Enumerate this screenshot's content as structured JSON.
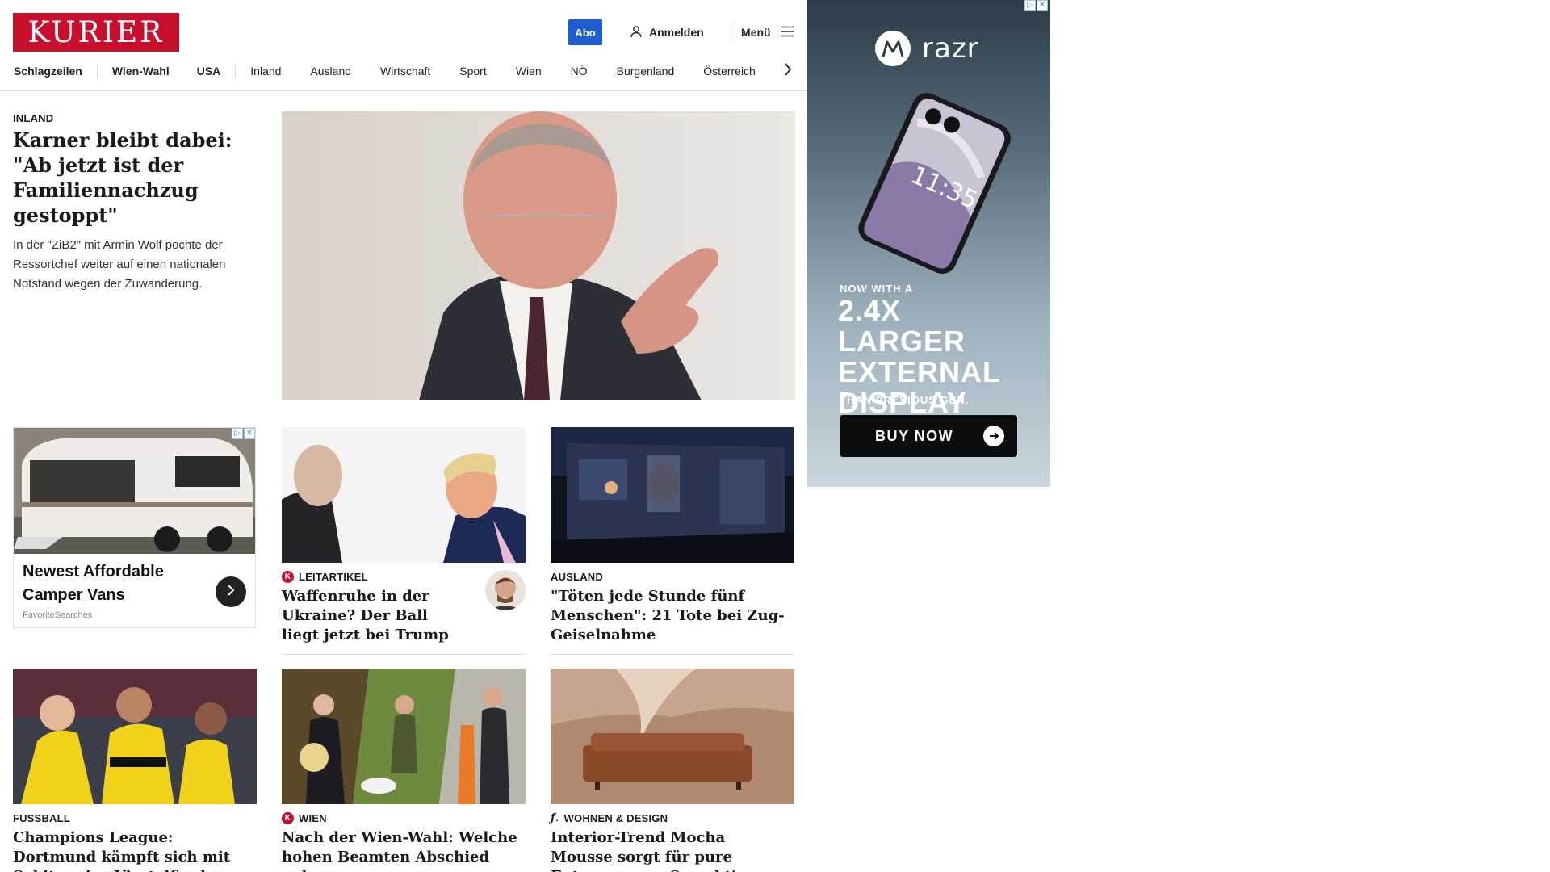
{
  "header": {
    "logo_text": "KURIER",
    "abo_label": "Abo",
    "login_label": "Anmelden",
    "menu_label": "Menü"
  },
  "nav": {
    "items": [
      "Schlagzeilen",
      "Wien-Wahl",
      "USA",
      "Inland",
      "Ausland",
      "Wirtschaft",
      "Sport",
      "Wien",
      "NÖ",
      "Burgenland",
      "Österreich"
    ]
  },
  "lead": {
    "kicker": "INLAND",
    "title": "Karner bleibt dabei: \"Ab jetzt ist der Familiennachzug gestoppt\"",
    "teaser": "In der \"ZiB2\" mit Armin Wolf pochte der Ressortchef weiter auf einen nationalen Notstand wegen der Zuwanderung."
  },
  "ad_card": {
    "title": "Newest Affordable Camper Vans",
    "source": "FavoriteSearches"
  },
  "cards": [
    {
      "kicker": "LEITARTIKEL",
      "title": "Waffenruhe in der Ukraine? Der Ball liegt jetzt bei Trump"
    },
    {
      "kicker": "AUSLAND",
      "title": "\"Töten jede Stunde fünf Menschen\": 21 Tote bei Zug-Geiselnahme"
    },
    {
      "kicker": "FUSSBALL",
      "title": "Champions League: Dortmund kämpft sich mit Sabitzer ins Viertelfinale"
    },
    {
      "kicker": "WIEN",
      "title": "Nach der Wien-Wahl: Welche hohen Beamten Abschied nehmen"
    },
    {
      "kicker": "WOHNEN & DESIGN",
      "title": "Interior-Trend Mocha Mousse sorgt für pure Entspannung: So geht's"
    }
  ],
  "side_ad": {
    "brand": "razr",
    "phone_time": "11:35",
    "line1": "NOW WITH A",
    "headline": "2.4X LARGER EXTERNAL DISPLAY",
    "line2": "THAN PREVIOUS GEN.",
    "cta": "BUY NOW"
  },
  "badges": {
    "k_badge": "K"
  },
  "colors": {
    "brand_red": "#c8102e",
    "abo_blue": "#1f5fd6"
  }
}
